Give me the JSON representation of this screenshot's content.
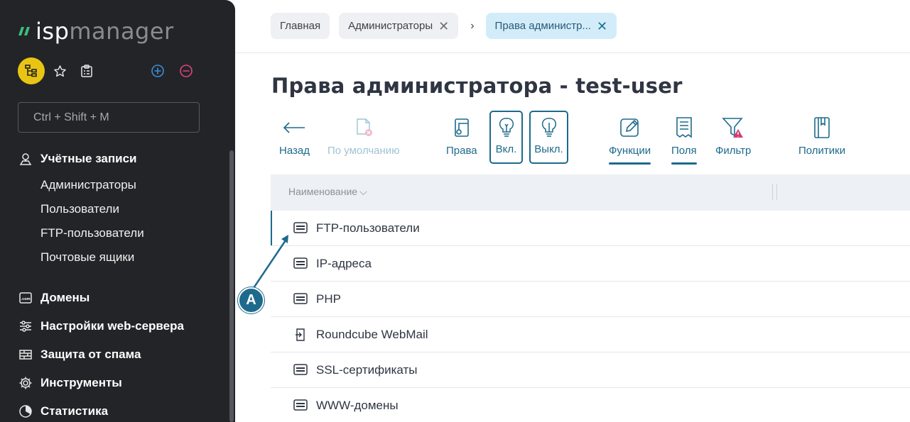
{
  "brand": {
    "isp": "isp",
    "manager": "manager"
  },
  "search": {
    "placeholder": "Ctrl + Shift + M"
  },
  "sidebar": {
    "accounts": {
      "label": "Учётные записи",
      "items": [
        "Администраторы",
        "Пользователи",
        "FTP-пользователи",
        "Почтовые ящики"
      ]
    },
    "sections": [
      {
        "label": "Домены",
        "icon": "domain-icon"
      },
      {
        "label": "Настройки web-сервера",
        "icon": "sliders-icon"
      },
      {
        "label": "Защита от спама",
        "icon": "firewall-icon"
      },
      {
        "label": "Инструменты",
        "icon": "gear-icon"
      },
      {
        "label": "Статистика",
        "icon": "pie-chart-icon"
      }
    ]
  },
  "breadcrumbs": [
    {
      "label": "Главная"
    },
    {
      "label": "Администраторы"
    },
    {
      "label": "Права администр..."
    }
  ],
  "page": {
    "title": "Права администратора - test-user"
  },
  "toolbar": {
    "back": "Назад",
    "default": "По умолчанию",
    "rights": "Права",
    "on": "Вкл.",
    "off": "Выкл.",
    "functions": "Функции",
    "fields": "Поля",
    "filter": "Фильтр",
    "policies": "Политики"
  },
  "table": {
    "column": "Наименование",
    "rows": [
      {
        "label": "FTP-пользователи",
        "icon": "module-icon"
      },
      {
        "label": "IP-адреса",
        "icon": "module-icon"
      },
      {
        "label": "PHP",
        "icon": "module-icon"
      },
      {
        "label": "Roundcube WebMail",
        "icon": "external-module-icon"
      },
      {
        "label": "SSL-сертификаты",
        "icon": "module-icon"
      },
      {
        "label": "WWW-домены",
        "icon": "module-icon"
      }
    ]
  },
  "callout": {
    "label": "A"
  },
  "colors": {
    "sidebar": "#232428",
    "accent": "#1d6a8c",
    "tree_button": "#e9c513"
  }
}
